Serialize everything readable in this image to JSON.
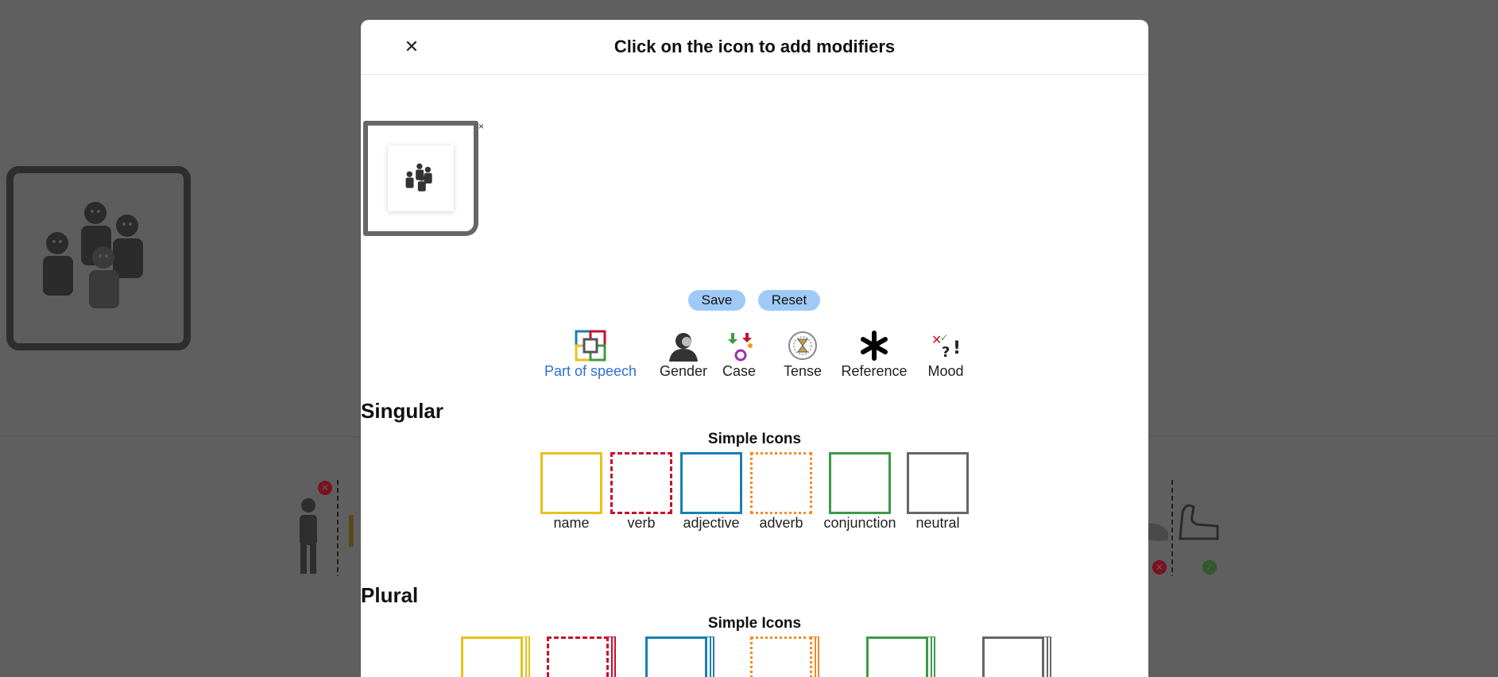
{
  "dialog": {
    "title": "Click on the icon to add modifiers",
    "close_glyph": "✕",
    "remove_glyph": "×",
    "save_label": "Save",
    "reset_label": "Reset"
  },
  "tabs": [
    {
      "label": "Part of speech",
      "icon": "part-of-speech-icon",
      "active": true
    },
    {
      "label": "Gender",
      "icon": "gender-icon",
      "active": false
    },
    {
      "label": "Case",
      "icon": "case-icon",
      "active": false
    },
    {
      "label": "Tense",
      "icon": "tense-icon",
      "active": false
    },
    {
      "label": "Reference",
      "icon": "asterisk-icon",
      "active": false
    },
    {
      "label": "Mood",
      "icon": "mood-icon",
      "active": false
    }
  ],
  "singular": {
    "heading": "Singular",
    "subheading": "Simple Icons",
    "items": [
      {
        "label": "name",
        "color": "#e8c11c"
      },
      {
        "label": "verb",
        "color": "#c8102e"
      },
      {
        "label": "adjective",
        "color": "#1a7fb5"
      },
      {
        "label": "adverb",
        "color": "#f08a24"
      },
      {
        "label": "conjunction",
        "color": "#3d9a47"
      },
      {
        "label": "neutral",
        "color": "#666666"
      }
    ]
  },
  "plural": {
    "heading": "Plural",
    "subheading": "Simple Icons",
    "items": [
      {
        "color": "#e8c11c"
      },
      {
        "color": "#c8102e"
      },
      {
        "color": "#1a7fb5"
      },
      {
        "color": "#f08a24"
      },
      {
        "color": "#3d9a47"
      },
      {
        "color": "#666666"
      }
    ]
  },
  "colors": {
    "overlay": "#5f5f5f",
    "button": "#9fcaf7",
    "active_tab": "#2f6fd6"
  }
}
